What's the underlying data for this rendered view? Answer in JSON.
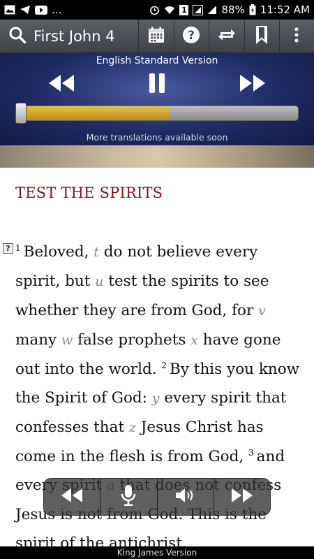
{
  "status_bar": {
    "battery": "88%",
    "time": "11:52 AM",
    "notification_badge": "1",
    "more": "..."
  },
  "app_bar": {
    "book_title": "First John 4",
    "icons": [
      "search-icon",
      "calendar-icon",
      "help-icon",
      "sync-icon",
      "bookmark-icon",
      "overflow-menu-icon"
    ]
  },
  "player": {
    "version": "English Standard Version",
    "more_translations": "More translations available soon",
    "progress": 0.54
  },
  "content": {
    "heading": "TEST THE SPIRITS",
    "note_marker": "?",
    "v1_num": "1",
    "v1_a": "Beloved, ",
    "v1_x1": "t",
    "v1_b": " do not believe every spirit, but ",
    "v1_x2": "u",
    "v1_c": " test the spirits to see whether they are from God, for ",
    "v1_x3": "v",
    "v1_d": " many ",
    "v1_x4": "w",
    "v1_e": " false prophets ",
    "v1_x5": "x",
    "v1_f": " have gone out into the world. ",
    "v2_num": "2",
    "v2_a": "By this you know the Spirit of God: ",
    "v2_x1": "y",
    "v2_b": " every spirit that confesses that ",
    "v2_x2": "z",
    "v2_c": " Jesus Christ has come in the flesh is from God, ",
    "v3_num": "3",
    "v3_a": "and every spirit ",
    "v3_x1": "a",
    "v3_b": " that does not confess Jesus is not from God. This is the spirit of the antichrist,"
  },
  "float_controls": {
    "icons": [
      "rewind-icon",
      "microphone-icon",
      "speaker-icon",
      "fast-forward-icon"
    ]
  },
  "bottom_bar": {
    "label": "King James Version"
  },
  "colors": {
    "heading": "#7a1515",
    "progress_fill": "#d4b030",
    "player_bg": "#1d2a63"
  }
}
